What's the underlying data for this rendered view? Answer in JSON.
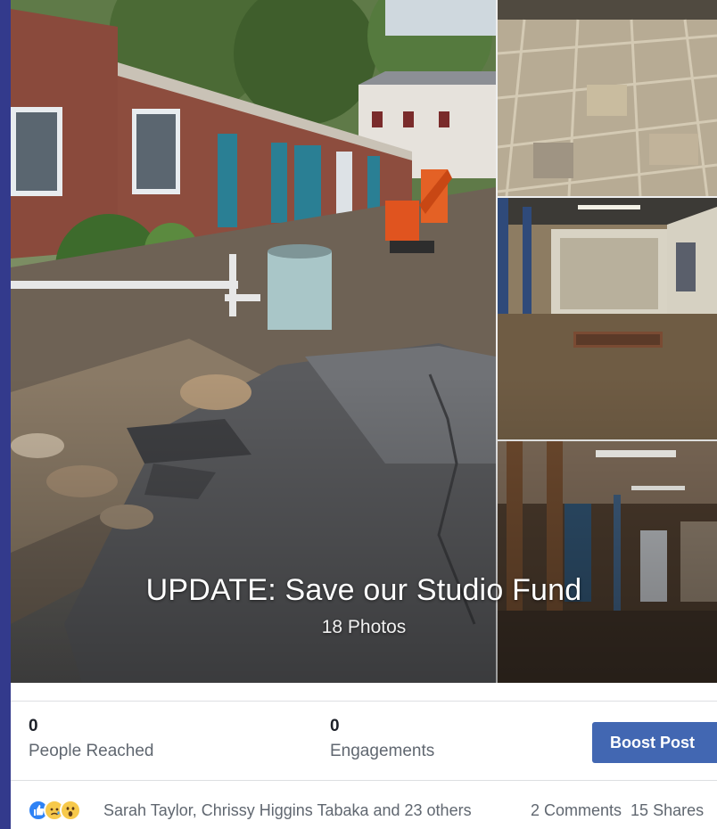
{
  "album": {
    "title": "UPDATE: Save our Studio Fund",
    "photo_count": "18 Photos"
  },
  "insights": {
    "people_reached_value": "0",
    "people_reached_label": "People Reached",
    "engagements_value": "0",
    "engagements_label": "Engagements",
    "boost_label": "Boost Post"
  },
  "reactions": {
    "icons": [
      "like-icon",
      "sad-icon",
      "wow-icon"
    ],
    "names": "Sarah Taylor, Chrissy Higgins Tabaka and 23 others",
    "comments": "2 Comments",
    "shares": "15 Shares"
  },
  "colors": {
    "page_background": "#333a8c",
    "boost_button": "#4267b2",
    "like_blue": "#2e82f5",
    "reaction_yellow": "#f7c94b"
  }
}
